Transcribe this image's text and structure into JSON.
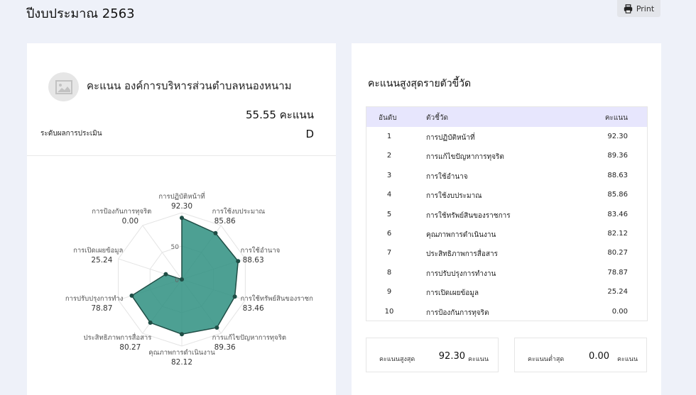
{
  "page": {
    "title": "ปีงบประมาณ 2563",
    "print_label": "Print"
  },
  "org": {
    "name": "คะแนน องค์การบริหารส่วนตำบลหนองหนาม",
    "score_text": "55.55 คะแนน",
    "level_label": "ระดับผลการประเมิน",
    "level": "D"
  },
  "chart_data": {
    "type": "radar",
    "title": "",
    "scale_max": 100,
    "scale_labels": [
      "0",
      "50"
    ],
    "categories": [
      "การปฏิบัติหน้าที่",
      "การใช้งบประมาณ",
      "การใช้อำนาจ",
      "การใช้ทรัพย์สินของราชก",
      "การแก้ไขปัญหาการทุจริต",
      "คุณภาพการดำเนินงาน",
      "ประสิทธิภาพการสื่อสาร",
      "การปรับปรุงการทำง",
      "การเปิดเผยข้อมูล",
      "การป้องกันการทุจริต"
    ],
    "values": [
      92.3,
      85.86,
      88.63,
      83.46,
      89.36,
      82.12,
      80.27,
      78.87,
      25.24,
      0.0
    ],
    "value_labels": [
      "92.30",
      "85.86",
      "88.63",
      "83.46",
      "89.36",
      "82.12",
      "80.27",
      "78.87",
      "25.24",
      "0.00"
    ],
    "fill_color": "#2e8f80",
    "line_color": "#1f4d45"
  },
  "ranking": {
    "title": "คะแนนสูงสุดรายตัวขี้วัด",
    "headers": {
      "rank": "อันดับ",
      "name": "ตัวชี้วัด",
      "score": "คะแนน"
    },
    "rows": [
      {
        "rank": "1",
        "name": "การปฏิบัติหน้าที่",
        "score": "92.30"
      },
      {
        "rank": "2",
        "name": "การแก้ไขปัญหาการทุจริต",
        "score": "89.36"
      },
      {
        "rank": "3",
        "name": "การใช้อำนาจ",
        "score": "88.63"
      },
      {
        "rank": "4",
        "name": "การใช้งบประมาณ",
        "score": "85.86"
      },
      {
        "rank": "5",
        "name": "การใช้ทรัพย์สินของราชการ",
        "score": "83.46"
      },
      {
        "rank": "6",
        "name": "คุณภาพการดำเนินงาน",
        "score": "82.12"
      },
      {
        "rank": "7",
        "name": "ประสิทธิภาพการสื่อสาร",
        "score": "80.27"
      },
      {
        "rank": "8",
        "name": "การปรับปรุงการทำงาน",
        "score": "78.87"
      },
      {
        "rank": "9",
        "name": "การเปิดเผยข้อมูล",
        "score": "25.24"
      },
      {
        "rank": "10",
        "name": "การป้องกันการทุจริต",
        "score": "0.00"
      }
    ]
  },
  "stats": {
    "max_label": "คะแนนสูงสุด",
    "max_value": "92.30",
    "min_label": "คะแนนต่ำสุด",
    "min_value": "0.00",
    "unit": "คะแนน"
  }
}
